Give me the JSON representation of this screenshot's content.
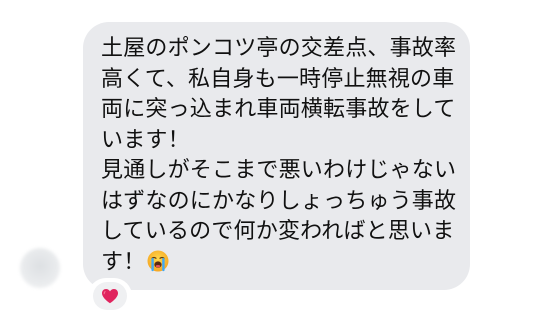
{
  "message": {
    "paragraph1_lines": [
      "土屋のポンコツ亭の交差点、事故率",
      "高くて、私自身も一時停止無視の車",
      "両に突っ込まれ車両横転事故をして",
      "います！"
    ],
    "paragraph2_lines": [
      "見通しがそこまで悪いわけじゃない",
      "はずなのにかなりしょっちゅう事故",
      "しているので何か変わればと思いま",
      "す！"
    ],
    "trailing_emoji": "crying-face-icon"
  },
  "reaction": {
    "icon": "heart-icon",
    "color": "#e0245e"
  },
  "colors": {
    "bubble": "#e9eaed",
    "text": "#111111"
  }
}
